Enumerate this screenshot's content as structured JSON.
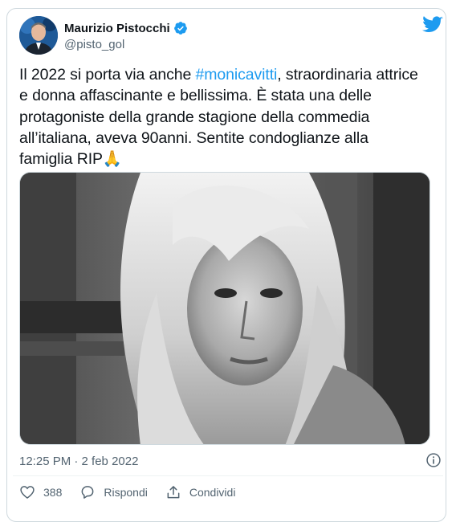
{
  "author": {
    "name": "Maurizio Pistocchi",
    "handle": "@pisto_gol"
  },
  "tweet": {
    "text_before": "Il 2022 si porta via anche ",
    "hashtag": "#monicavitti",
    "text_after": ", straordinaria attrice e donna affascinante e bellissima. È stata una delle protagoniste della grande stagione della commedia all’italiana, aveva 90anni. Sentite condoglianze alla famiglia RIP🙏"
  },
  "media": {
    "kind": "black-and-white portrait photo"
  },
  "meta": {
    "timestamp": "12:25 PM · 2 feb 2022"
  },
  "actions": {
    "likes": "388",
    "reply_label": "Rispondi",
    "share_label": "Condividi"
  },
  "colors": {
    "accent": "#1d9bf0",
    "text": "#0f1419",
    "secondary": "#536471",
    "border": "#cfd9de"
  },
  "icons": [
    "verified-badge-icon",
    "twitter-bird-icon",
    "info-icon",
    "heart-icon",
    "reply-icon",
    "share-icon"
  ]
}
